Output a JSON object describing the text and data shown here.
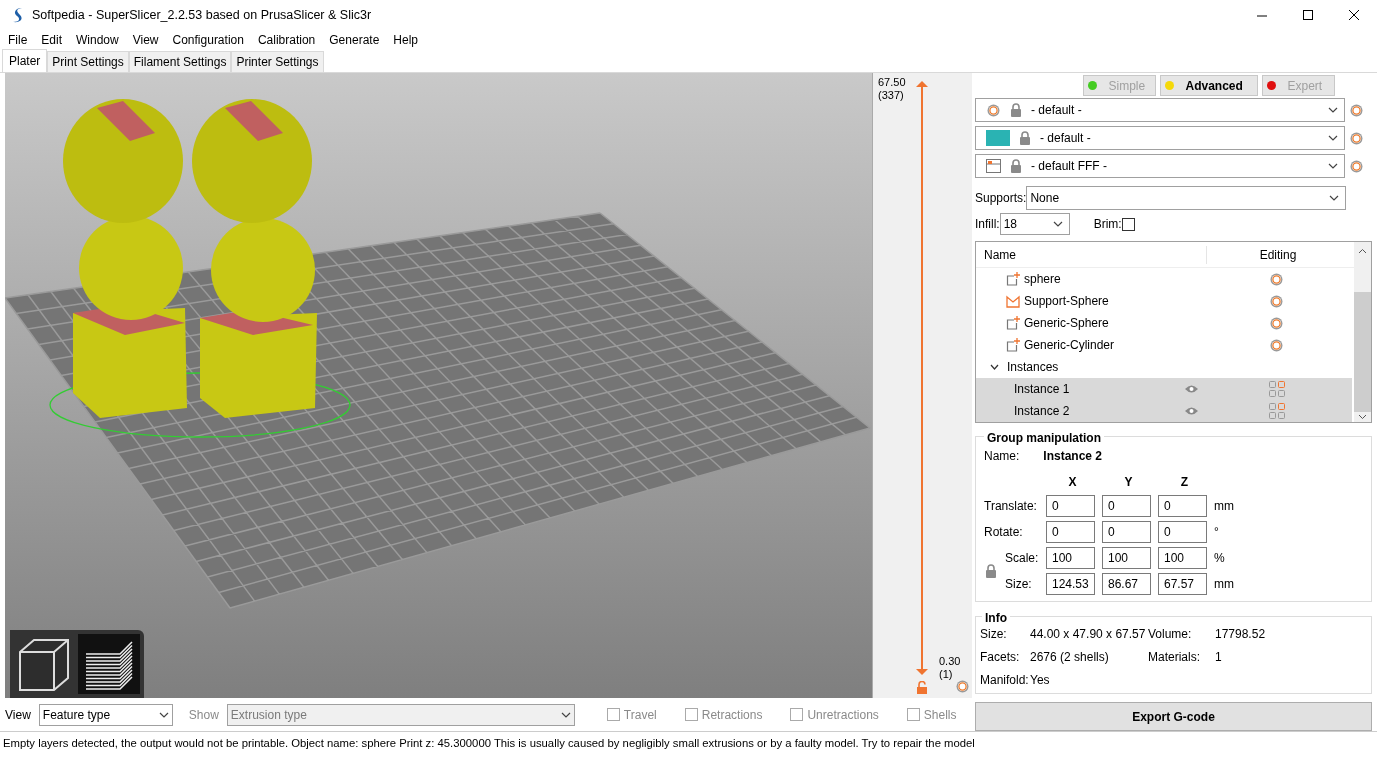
{
  "window": {
    "title": "Softpedia - SuperSlicer_2.2.53 based on PrusaSlicer & Slic3r"
  },
  "menu": [
    "File",
    "Edit",
    "Window",
    "View",
    "Configuration",
    "Calibration",
    "Generate",
    "Help"
  ],
  "tabs": [
    {
      "label": "Plater",
      "selected": true
    },
    {
      "label": "Print Settings",
      "selected": false
    },
    {
      "label": "Filament Settings",
      "selected": false
    },
    {
      "label": "Printer Settings",
      "selected": false
    }
  ],
  "layer_slider": {
    "top_value": "67.50",
    "top_layer": "(337)",
    "bottom_value": "0.30",
    "bottom_layer": "(1)"
  },
  "modes": [
    {
      "label": "Simple",
      "color": "#44cc22",
      "selected": false
    },
    {
      "label": "Advanced",
      "color": "#f5d90a",
      "selected": true
    },
    {
      "label": "Expert",
      "color": "#e01010",
      "selected": false
    }
  ],
  "presets": [
    {
      "kind": "print",
      "value": "- default -"
    },
    {
      "kind": "filament",
      "value": "- default -",
      "color": "#2ab3b3"
    },
    {
      "kind": "printer",
      "value": "- default FFF -"
    }
  ],
  "supports": {
    "label": "Supports:",
    "value": "None"
  },
  "infill": {
    "label": "Infill:",
    "value": "18"
  },
  "brim": {
    "label": "Brim:",
    "checked": false
  },
  "object_list": {
    "columns": [
      "Name",
      "Editing"
    ],
    "items": [
      {
        "kind": "part",
        "label": "sphere"
      },
      {
        "kind": "support",
        "label": "Support-Sphere"
      },
      {
        "kind": "part",
        "label": "Generic-Sphere"
      },
      {
        "kind": "part",
        "label": "Generic-Cylinder"
      },
      {
        "kind": "group",
        "label": "Instances",
        "expanded": true,
        "children": [
          {
            "label": "Instance 1",
            "selected": true
          },
          {
            "label": "Instance 2",
            "selected": true
          }
        ]
      }
    ]
  },
  "manipulation": {
    "title": "Group manipulation",
    "name_label": "Name:",
    "name_value": "Instance 2",
    "axes": [
      "X",
      "Y",
      "Z"
    ],
    "scale_locked": true,
    "rows": [
      {
        "label": "Translate:",
        "values": [
          "0",
          "0",
          "0"
        ],
        "unit": "mm"
      },
      {
        "label": "Rotate:",
        "values": [
          "0",
          "0",
          "0"
        ],
        "unit": "°"
      },
      {
        "label": "Scale:",
        "values": [
          "100",
          "100",
          "100"
        ],
        "unit": "%"
      },
      {
        "label": "Size:",
        "values": [
          "124.53",
          "86.67",
          "67.57"
        ],
        "unit": "mm"
      }
    ]
  },
  "info": {
    "title": "Info",
    "fields": [
      {
        "label": "Size:",
        "value": "44.00 x 47.90 x 67.57"
      },
      {
        "label": "Volume:",
        "value": "17798.52"
      },
      {
        "label": "Facets:",
        "value": "2676 (2 shells)"
      },
      {
        "label": "Materials:",
        "value": "1"
      },
      {
        "label": "Manifold:",
        "value": "Yes"
      }
    ]
  },
  "export_button": "Export G-code",
  "bottom_bar": {
    "view_label": "View",
    "view_value": "Feature type",
    "show_label": "Show",
    "show_value": "Extrusion type",
    "show_disabled": true,
    "options": [
      {
        "label": "Travel",
        "checked": false
      },
      {
        "label": "Retractions",
        "checked": false
      },
      {
        "label": "Unretractions",
        "checked": false
      },
      {
        "label": "Shells",
        "checked": false
      }
    ]
  },
  "status_bar": "Empty layers detected, the output would not be printable.  Object name: sphere Print z: 45.300000  This is usually caused by negligibly small extrusions or by a faulty model. Try to repair the model"
}
